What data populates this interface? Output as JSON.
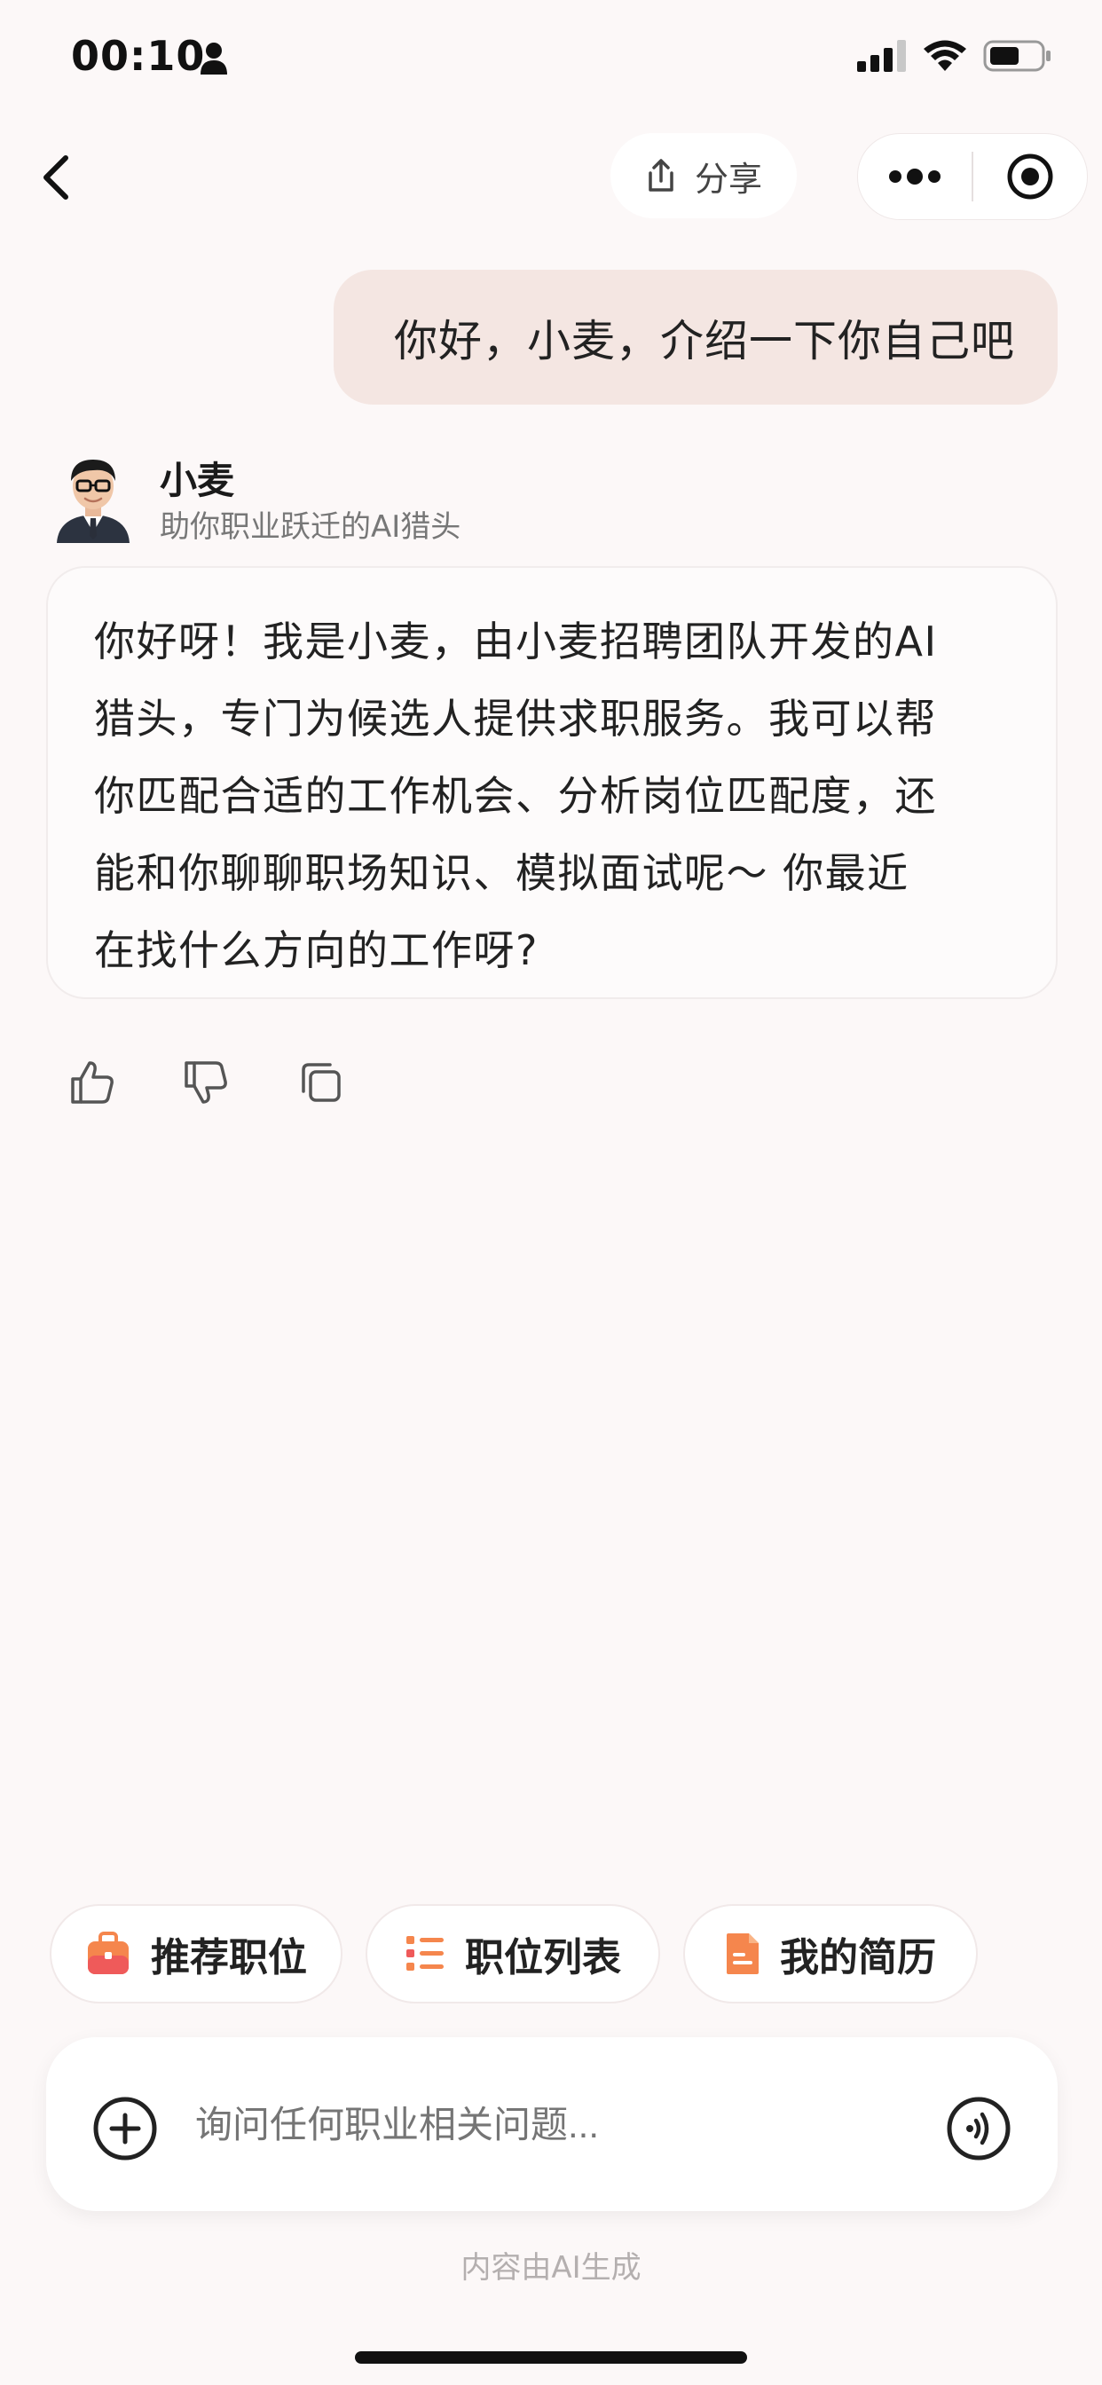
{
  "status": {
    "time": "00:10"
  },
  "nav": {
    "share_label": "分享"
  },
  "chat": {
    "user_message": "你好，小麦，介绍一下你自己吧",
    "bot_name": "小麦",
    "bot_subtitle": "助你职业跃迁的AI猎头",
    "reply_lines": [
      "你好呀！我是小麦，由小麦招聘团队开发的AI",
      "猎头，专门为候选人提供求职服务。我可以帮",
      "你匹配合适的工作机会、分析岗位匹配度，还",
      "能和你聊聊职场知识、模拟面试呢～ 你最近",
      "在找什么方向的工作呀?"
    ]
  },
  "quick_actions": [
    {
      "label": "推荐职位",
      "icon": "briefcase-icon"
    },
    {
      "label": "职位列表",
      "icon": "list-icon"
    },
    {
      "label": "我的简历",
      "icon": "document-icon"
    }
  ],
  "input": {
    "placeholder": "询问任何职业相关问题..."
  },
  "footer": {
    "ai_note": "内容由AI生成"
  },
  "colors": {
    "background": "#fcf8f8",
    "user_bubble": "#f4e6e2",
    "accent_orange": "#f5864d",
    "accent_red": "#ef5a5a"
  }
}
